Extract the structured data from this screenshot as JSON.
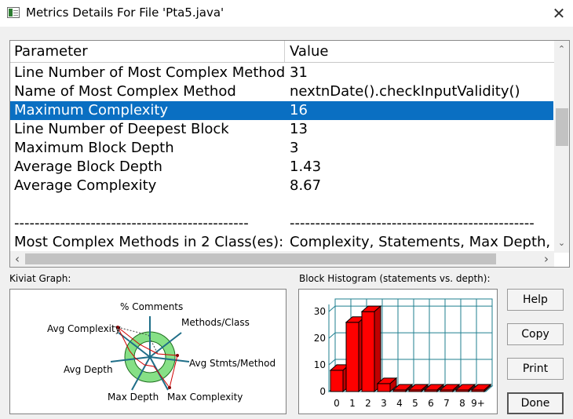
{
  "window": {
    "title": "Metrics Details For File 'Pta5.java'"
  },
  "table": {
    "headers": [
      "Parameter",
      "Value"
    ],
    "rows": [
      {
        "param": "Line Number of Most Complex Method",
        "value": "31"
      },
      {
        "param": "Name of Most Complex Method",
        "value": "nextnDate().checkInputValidity()"
      },
      {
        "param": "Maximum Complexity",
        "value": "16"
      },
      {
        "param": "Line Number of Deepest Block",
        "value": "13"
      },
      {
        "param": "Maximum Block Depth",
        "value": "3"
      },
      {
        "param": "Average Block Depth",
        "value": "1.43"
      },
      {
        "param": "Average Complexity",
        "value": "8.67"
      },
      {
        "param": "",
        "value": ""
      },
      {
        "param": "----------------------------------------------",
        "value": "------------------------------------------------"
      },
      {
        "param": "Most Complex Methods in 2 Class(es):",
        "value": "Complexity, Statements, Max Depth, Calls"
      }
    ],
    "selected_row": "Maximum Complexity"
  },
  "kiviat": {
    "label": "Kiviat Graph:",
    "axes": [
      "% Comments",
      "Methods/Class",
      "Avg Stmts/Method",
      "Max Complexity",
      "Max Depth",
      "Avg Depth",
      "Avg Complexity"
    ]
  },
  "histogram": {
    "label": "Block Histogram (statements vs. depth):",
    "yticks": [
      "30",
      "20",
      "10",
      "0"
    ],
    "categories": [
      "0",
      "1",
      "2",
      "3",
      "4",
      "5",
      "6",
      "7",
      "8",
      "9+"
    ]
  },
  "chart_data": {
    "type": "bar",
    "title": "Block Histogram (statements vs. depth):",
    "categories": [
      "0",
      "1",
      "2",
      "3",
      "4",
      "5",
      "6",
      "7",
      "8",
      "9+"
    ],
    "values": [
      8,
      26,
      30,
      3,
      0,
      0,
      0,
      0,
      0,
      0
    ],
    "ylim": [
      0,
      33
    ],
    "grid": true,
    "color": "#ff0000"
  },
  "buttons": {
    "help": "Help",
    "copy": "Copy",
    "print": "Print",
    "done": "Done"
  }
}
